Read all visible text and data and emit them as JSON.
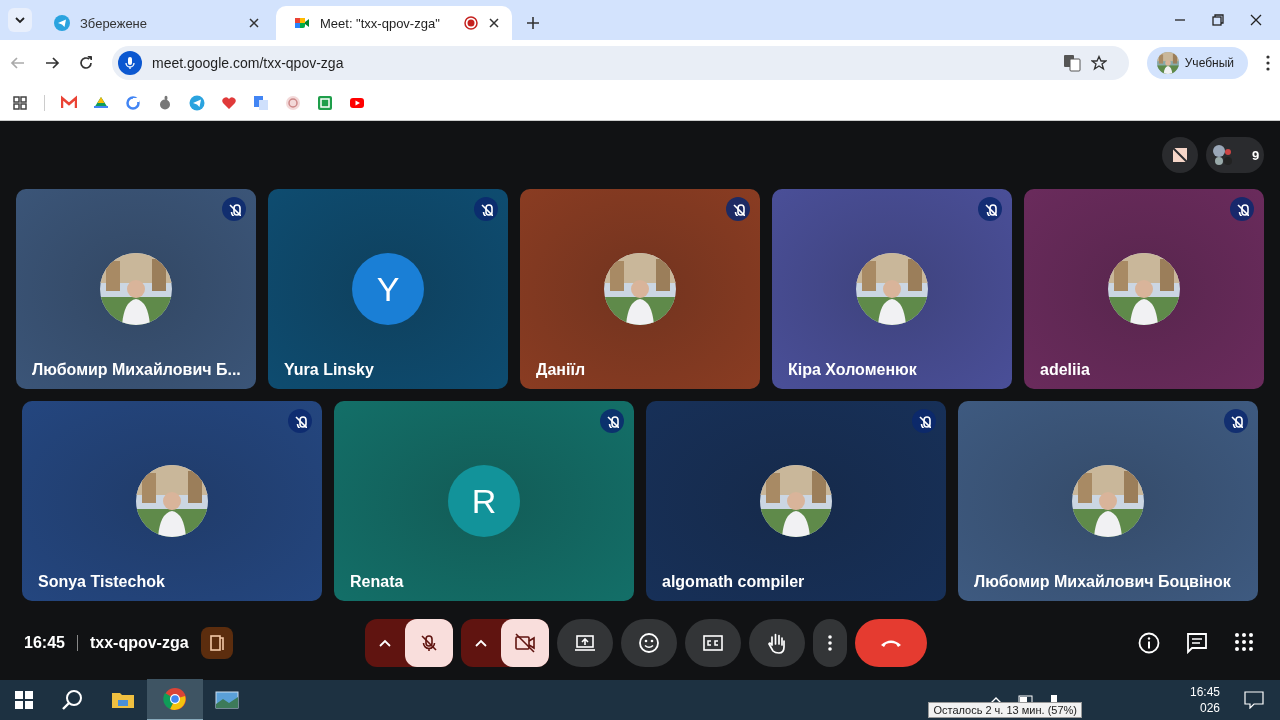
{
  "browser": {
    "tabs": [
      {
        "title": "Збережене",
        "selected": false,
        "recording": false
      },
      {
        "title": "Meet: \"txx-qpov-zga\"",
        "selected": true,
        "recording": true
      }
    ],
    "url": "meet.google.com/txx-qpov-zga",
    "profile": "Учебный"
  },
  "meet": {
    "participant_count": "9",
    "rows": [
      {
        "tiles": [
          {
            "name": "Любомир Михайлович Б...",
            "muted": true,
            "color": "#3b5578"
          },
          {
            "name": "Yura Linsky",
            "muted": true,
            "color": "#0e4c70",
            "avatar": {
              "kind": "letter",
              "letter": "Y",
              "color": "#1a7fd6"
            }
          },
          {
            "name": "Даніїл",
            "muted": true,
            "color": "#8a3c22"
          },
          {
            "name": "Кіра Холоменюк",
            "muted": true,
            "color": "#4a4f98"
          },
          {
            "name": "adeliia",
            "muted": true,
            "color": "#6a2b5c"
          }
        ]
      },
      {
        "tiles": [
          {
            "name": "Sonya Tistechok",
            "muted": true,
            "color": "#24467f"
          },
          {
            "name": "Renata",
            "muted": true,
            "color": "#136f68",
            "avatar": {
              "kind": "letter",
              "letter": "R",
              "color": "#12939a"
            }
          },
          {
            "name": "algomath compiler",
            "muted": true,
            "color": "#173058"
          },
          {
            "name": "Любомир Михайлович Боцвінок",
            "muted": true,
            "color": "#3e5a80"
          }
        ]
      }
    ],
    "time": "16:45",
    "meeting_code": "txx-qpov-zga",
    "mic_on": false,
    "camera_on": false
  },
  "taskbar": {
    "time": "16:45",
    "date": "026",
    "tooltip": "Осталось 2 ч. 13 мин. (57%)"
  }
}
